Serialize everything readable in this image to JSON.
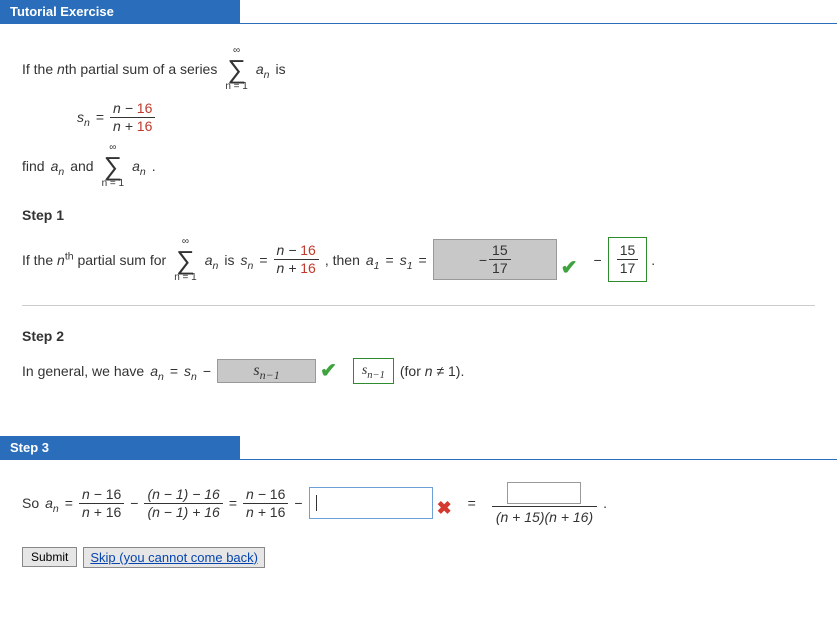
{
  "header": {
    "tutorial_title": "Tutorial Exercise",
    "step3_title": "Step 3"
  },
  "intro": {
    "line1_a": "If the ",
    "line1_b": "n",
    "line1_c": "th partial sum of a series ",
    "line1_d": " is",
    "sum_top": "∞",
    "sum_bottom": "n = 1",
    "sum_term_a": "a",
    "sum_term_sub": "n",
    "sn_lhs_s": "s",
    "sn_lhs_sub": "n",
    "sn_eq": " = ",
    "sn_num_a": "n − ",
    "sn_num_b": "16",
    "sn_den_a": "n + ",
    "sn_den_b": "16",
    "find_a": "find ",
    "find_b": "a",
    "find_sub": "n",
    "find_c": " and ",
    "find_period": "."
  },
  "step1": {
    "heading": "Step 1",
    "text_a": "If the ",
    "text_b": "n",
    "text_sup": "th",
    "text_c": " partial sum for ",
    "text_d": " is ",
    "sn_s": "s",
    "sn_sub": "n",
    "eq": " = ",
    "frac_num_a": "n − ",
    "frac_num_b": "16",
    "frac_den_a": "n + ",
    "frac_den_b": "16",
    "comma_then": ", then ",
    "a1_a": "a",
    "a1_sub": "1",
    "eq2": " = ",
    "s1_s": "s",
    "s1_sub": "1",
    "eq3": " = ",
    "answer_minus": "−",
    "answer_num": "15",
    "answer_den": "17",
    "confirm_num": "15",
    "confirm_den": "17"
  },
  "step2": {
    "heading": "Step 2",
    "text_a": "In general, we have ",
    "an_a": "a",
    "an_sub": "n",
    "eq": " = ",
    "sn_s": "s",
    "sn_sub": "n",
    "minus": " − ",
    "grey_val_s": "s",
    "grey_val_sub": "n−1",
    "green_val_s": "s",
    "green_val_sub": "n−1",
    "paren_a": " (for ",
    "paren_b": "n",
    "paren_c": " ≠ 1)."
  },
  "step3": {
    "so_a": "So ",
    "an_a": "a",
    "an_sub": "n",
    "eq": " = ",
    "f1_num_a": "n − ",
    "f1_num_b": "16",
    "f1_den_a": "n + ",
    "f1_den_b": "16",
    "minus": " − ",
    "f2_num": "(n − 1) − 16",
    "f2_den": "(n − 1) + 16",
    "eq2": " = ",
    "f3_num_a": "n − ",
    "f3_num_b": "16",
    "f3_den_a": "n + ",
    "f3_den_b": "16",
    "minus2": " − ",
    "eq3": " = ",
    "final_den": "(n + 15)(n + 16)",
    "period": "."
  },
  "actions": {
    "submit_label": "Submit",
    "skip_label": "Skip (you cannot come back)"
  }
}
